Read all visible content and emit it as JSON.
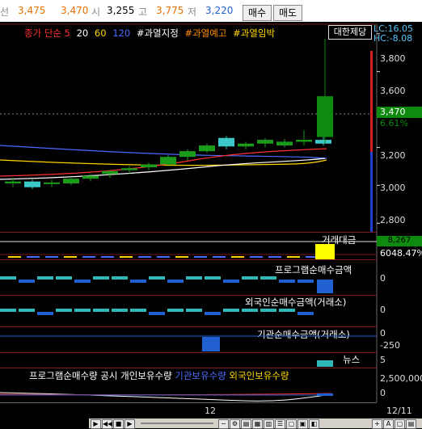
{
  "topbar": {
    "prefix": "선",
    "price1": "3,475",
    "price2": "3,470",
    "open_label": "시",
    "open": "3,255",
    "high_label": "고",
    "high": "3,775",
    "low_label": "저",
    "low": "3,220",
    "buy_label": "매수",
    "sell_label": "매도"
  },
  "legend": {
    "ma_label": "종가 단순 5",
    "ma20": "20",
    "ma60": "60",
    "ma120": "120",
    "tag1": "#과열지정",
    "tag2": "#과열예고",
    "tag3": "#과열임박",
    "broker": "대한제당"
  },
  "corner": {
    "lc": "LC:16.05",
    "hc": "HC:-8.08"
  },
  "price_axis": [
    "3,800",
    "3,600",
    "3,470",
    "3,200",
    "3,000",
    "2,800"
  ],
  "change_pct": "6.61%",
  "panels": {
    "volume": {
      "title": "거래대금",
      "value": "6048.47%",
      "value2": "8,267"
    },
    "program": {
      "title": "프로그램순매수금액",
      "value": "0"
    },
    "foreign": {
      "title": "외국인순매수금액(거래소)",
      "value": "0"
    },
    "institution": {
      "title": "기관순매수금액(거래소)",
      "value": "0",
      "value2": "-250"
    },
    "news": {
      "title": "뉴스",
      "value": "5"
    },
    "holdings": {
      "t1": "프로그램순매수량",
      "t2": "공시",
      "t3": "개인보유수량",
      "t4": "기관보유수량",
      "t5": "외국인보유수량",
      "value1": "2,500,000",
      "value2": "0"
    }
  },
  "date_axis": {
    "label_mid": "12",
    "label_right": "12/11"
  },
  "colors": {
    "up": "#1a9c1a",
    "up_current": "#0e8a0e",
    "down": "#3dc8c8",
    "ma5": "#ff3030",
    "ma20": "#ffffff",
    "ma60": "#ffd700",
    "ma120": "#4a6cff",
    "panel_up": "#2fb8b8",
    "panel_down": "#2060d0"
  },
  "chart_data": {
    "type": "candlestick",
    "candles": [
      {
        "o": 3010,
        "h": 3040,
        "l": 2990,
        "c": 3020
      },
      {
        "o": 3020,
        "h": 3030,
        "l": 2980,
        "c": 2990
      },
      {
        "o": 3010,
        "h": 3030,
        "l": 2990,
        "c": 3015
      },
      {
        "o": 3010,
        "h": 3045,
        "l": 3000,
        "c": 3035
      },
      {
        "o": 3035,
        "h": 3060,
        "l": 3020,
        "c": 3050
      },
      {
        "o": 3060,
        "h": 3080,
        "l": 3040,
        "c": 3075
      },
      {
        "o": 3080,
        "h": 3100,
        "l": 3060,
        "c": 3090
      },
      {
        "o": 3095,
        "h": 3120,
        "l": 3080,
        "c": 3110
      },
      {
        "o": 3110,
        "h": 3160,
        "l": 3100,
        "c": 3150
      },
      {
        "o": 3150,
        "h": 3190,
        "l": 3130,
        "c": 3180
      },
      {
        "o": 3180,
        "h": 3220,
        "l": 3170,
        "c": 3210
      },
      {
        "o": 3250,
        "h": 3260,
        "l": 3190,
        "c": 3205
      },
      {
        "o": 3205,
        "h": 3230,
        "l": 3190,
        "c": 3220
      },
      {
        "o": 3220,
        "h": 3250,
        "l": 3200,
        "c": 3240
      },
      {
        "o": 3210,
        "h": 3245,
        "l": 3200,
        "c": 3230
      },
      {
        "o": 3230,
        "h": 3290,
        "l": 3210,
        "c": 3240
      },
      {
        "o": 3240,
        "h": 3270,
        "l": 3210,
        "c": 3220
      },
      {
        "o": 3255,
        "h": 3775,
        "l": 3220,
        "c": 3470
      }
    ],
    "ylim": [
      2750,
      3850
    ]
  }
}
